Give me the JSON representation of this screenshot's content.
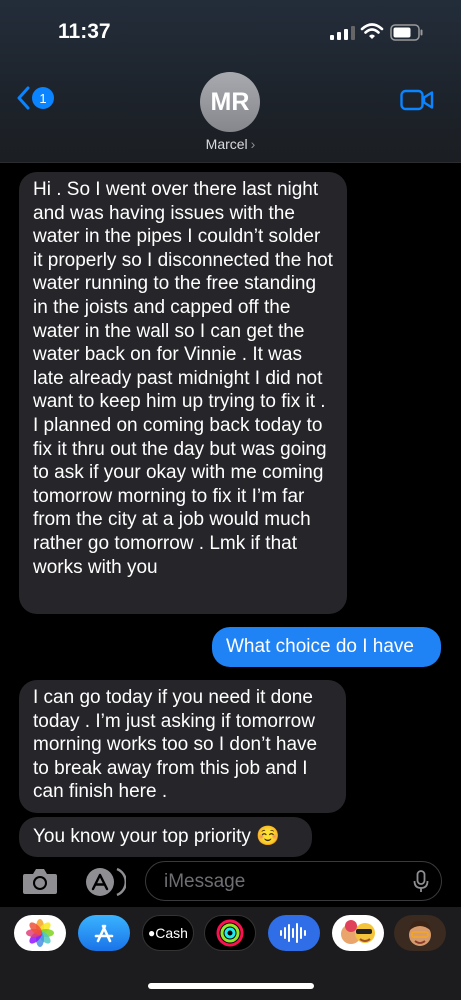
{
  "status_bar": {
    "time": "11:37"
  },
  "nav": {
    "back_badge": "1",
    "avatar_initials": "MR",
    "contact_name": "Marcel",
    "contact_chevron": "›"
  },
  "messages": [
    {
      "direction": "incoming",
      "text": "Hi . So I went over there last night and was having issues with the water in the pipes I couldn’t solder it properly so I disconnected the hot water running to the free standing in the joists and capped off the water in the wall so I can get the water back on for Vinnie . It was late already past midnight I did not want to keep him up trying to fix it . I planned on coming back today to fix it thru out the day but was going to ask if your okay with me coming tomorrow morning to fix it I’m far from the city at a job would much rather go tomorrow . Lmk if that works with you"
    },
    {
      "direction": "outgoing",
      "text": "What choice do I have"
    },
    {
      "direction": "incoming",
      "text": "I can go today if you need it done today . I’m just asking if tomorrow morning works too so I don’t have to break away from this job and I can finish here ."
    },
    {
      "direction": "incoming",
      "text": "You know your top priority ☺️"
    }
  ],
  "composer": {
    "placeholder": "iMessage"
  },
  "app_drawer": [
    {
      "name": "photos-app",
      "icon": "photos-icon"
    },
    {
      "name": "app-store-app",
      "icon": "app-store-icon"
    },
    {
      "name": "apple-cash-app",
      "icon": "apple-cash-icon",
      "label": "Cash"
    },
    {
      "name": "activity-app",
      "icon": "activity-rings-icon"
    },
    {
      "name": "audio-message-app",
      "icon": "waveform-icon"
    },
    {
      "name": "memoji-stickers-app",
      "icon": "memoji-icon"
    },
    {
      "name": "memoji-app",
      "icon": "memoji-icon"
    }
  ],
  "colors": {
    "outgoing_bubble": "#1f82f5",
    "incoming_bubble": "#26252a",
    "accent": "#0a84ff"
  }
}
